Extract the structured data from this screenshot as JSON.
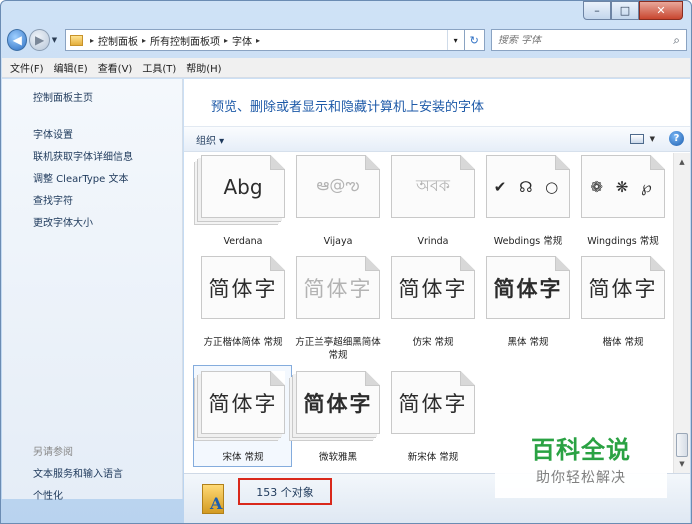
{
  "window": {
    "caption": {
      "minimize": "–",
      "maximize": "□",
      "close": "✕"
    }
  },
  "nav": {
    "back_glyph": "◀",
    "forward_glyph": "▶",
    "dropdown_glyph": "▼"
  },
  "address": {
    "crumbs": [
      "控制面板",
      "所有控制面板项",
      "字体"
    ],
    "separator": "▸",
    "dropdown_glyph": "▾",
    "refresh_glyph": "↻"
  },
  "search": {
    "placeholder": "搜索 字体",
    "icon_glyph": "⌕"
  },
  "menu": [
    "文件(F)",
    "编辑(E)",
    "查看(V)",
    "工具(T)",
    "帮助(H)"
  ],
  "sidebar": {
    "home": "控制面板主页",
    "links": [
      "字体设置",
      "联机获取字体详细信息",
      "调整 ClearType 文本",
      "查找字符",
      "更改字体大小"
    ],
    "see_also": "另请参阅",
    "bottom_links": [
      "文本服务和输入语言",
      "个性化"
    ]
  },
  "content": {
    "title": "预览、删除或者显示和隐藏计算机上安装的字体",
    "organize": "组织 ▾",
    "view_drop": "▼",
    "help": "?",
    "scroll_up": "▲",
    "scroll_down": "▼"
  },
  "fonts": [
    {
      "sample": "Abg",
      "label": "Verdana",
      "style": "normal",
      "stack": true
    },
    {
      "sample": "ఆ@ఌ",
      "label": "Vijaya",
      "style": "faint",
      "stack": false
    },
    {
      "sample": "অবক",
      "label": "Vrinda",
      "style": "faint",
      "stack": false
    },
    {
      "sample": "✔ ☊ ○",
      "label": "Webdings 常规",
      "style": "sym",
      "stack": false
    },
    {
      "sample": "❁ ❋ ℘",
      "label": "Wingdings 常规",
      "style": "sym",
      "stack": false
    },
    {
      "sample": "简体字",
      "label": "方正楷体简体 常规",
      "style": "cjk",
      "stack": false
    },
    {
      "sample": "简体字",
      "label": "方正兰亭超细黑简体 常规",
      "style": "faintcjk",
      "stack": false
    },
    {
      "sample": "简体字",
      "label": "仿宋 常规",
      "style": "cjkserif",
      "stack": false
    },
    {
      "sample": "简体字",
      "label": "黑体 常规",
      "style": "cjkbold",
      "stack": false
    },
    {
      "sample": "简体字",
      "label": "楷体 常规",
      "style": "cjk",
      "stack": false
    },
    {
      "sample": "简体字",
      "label": "宋体 常规",
      "style": "cjkserif",
      "stack": true,
      "selected": true
    },
    {
      "sample": "简体字",
      "label": "微软雅黑",
      "style": "cjkbold",
      "stack": true
    },
    {
      "sample": "简体字",
      "label": "新宋体 常规",
      "style": "cjkserif",
      "stack": false
    }
  ],
  "status": {
    "count": "153 个对象"
  },
  "watermark": {
    "title": "百科全说",
    "subtitle": "助你轻松解决"
  }
}
